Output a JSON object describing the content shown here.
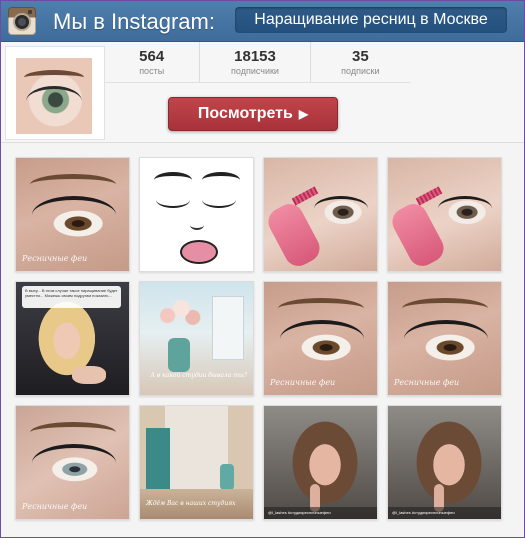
{
  "header": {
    "title": "Мы в Instagram:",
    "subtitle": "Наращивание ресниц в Москве",
    "logo_icon": "instagram-camera-icon"
  },
  "profile": {
    "stats": [
      {
        "value": "564",
        "label": "посты"
      },
      {
        "value": "18153",
        "label": "подписчики"
      },
      {
        "value": "35",
        "label": "подписки"
      }
    ],
    "view_button": {
      "label": "Посмотреть",
      "arrow": "▶"
    }
  },
  "grid": {
    "tiles": [
      {
        "kind": "eye-closeup"
      },
      {
        "kind": "face-drawing"
      },
      {
        "kind": "lash-applicator"
      },
      {
        "kind": "lash-applicator"
      },
      {
        "kind": "blonde-photo",
        "caption": "В выху... В этом случае такое наращивание будет уместно... Можешь своим подругам показать..."
      },
      {
        "kind": "studio-photo",
        "caption": "А в какой студии бывала ты?"
      },
      {
        "kind": "eye-closeup"
      },
      {
        "kind": "eye-closeup"
      },
      {
        "kind": "eye-closeup"
      },
      {
        "kind": "corridor-photo",
        "caption": "Ждём Вас в наших студиях"
      },
      {
        "kind": "selfie-photo",
        "caption": "@l_lashes   #студияресничныефеи"
      },
      {
        "kind": "selfie-photo",
        "caption": "@l_lashes   #студияресничныефеи"
      }
    ],
    "watermark": "Ресничные феи"
  }
}
